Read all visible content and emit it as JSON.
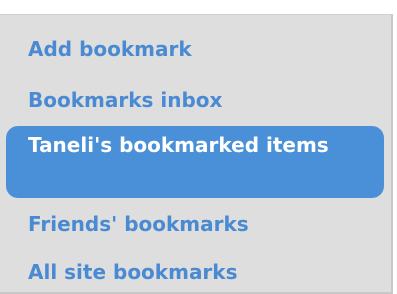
{
  "menu": {
    "items": [
      {
        "label": "Add bookmark",
        "selected": false
      },
      {
        "label": "Bookmarks inbox",
        "selected": false
      },
      {
        "label": "Taneli's bookmarked items",
        "selected": true
      },
      {
        "label": "Friends' bookmarks",
        "selected": false
      },
      {
        "label": "All site bookmarks",
        "selected": false
      }
    ]
  },
  "colors": {
    "link": "#4a8ad2",
    "selected_background": "#4a90d8",
    "selected_text": "#ffffff",
    "panel_background": "#dedede"
  }
}
